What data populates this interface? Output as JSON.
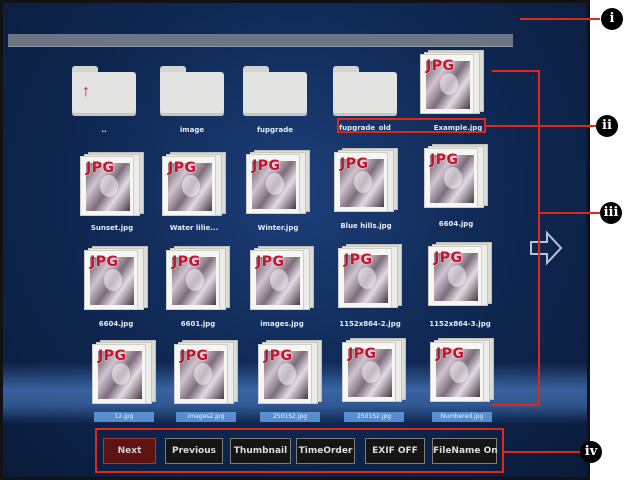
{
  "screen": {
    "topbar": {
      "text": ""
    },
    "folders": [
      {
        "name": "..",
        "mark": "↑"
      },
      {
        "name": "image",
        "mark": ""
      },
      {
        "name": "fupgrade",
        "mark": ""
      },
      {
        "name": "fupgrade_old",
        "mark": ""
      }
    ],
    "files": [
      {
        "name": "Example.jpg",
        "badge": "JPG"
      },
      {
        "name": "Sunset.jpg",
        "badge": "JPG"
      },
      {
        "name": "Water lilie...",
        "badge": "JPG"
      },
      {
        "name": "Winter.jpg",
        "badge": "JPG"
      },
      {
        "name": "Blue hills.jpg",
        "badge": "JPG"
      },
      {
        "name": "6604.jpg",
        "badge": "JPG"
      },
      {
        "name": "6604.jpg",
        "badge": "JPG"
      },
      {
        "name": "6601.jpg",
        "badge": "JPG"
      },
      {
        "name": "images.jpg",
        "badge": "JPG"
      },
      {
        "name": "1152x864-2.jpg",
        "badge": "JPG"
      },
      {
        "name": "1152x864-3.jpg",
        "badge": "JPG"
      },
      {
        "name": "12.jpg",
        "badge": "JPG"
      },
      {
        "name": "images2.jpg",
        "badge": "JPG"
      },
      {
        "name": "2501S2.jpg",
        "badge": "JPG"
      },
      {
        "name": "2501S2.jpg",
        "badge": "JPG"
      },
      {
        "name": "Numbered.jpg",
        "badge": "JPG"
      }
    ],
    "next_page_icon": "right-arrow-outline-icon"
  },
  "toolbar": {
    "buttons": [
      {
        "label": "Next",
        "active": true
      },
      {
        "label": "Previous",
        "active": false
      },
      {
        "label": "Thumbnail",
        "active": false
      },
      {
        "label": "TimeOrder",
        "active": false
      },
      {
        "label": "EXIF OFF",
        "active": false
      },
      {
        "label": "FileName On",
        "active": false
      }
    ]
  },
  "callouts": [
    {
      "id": "i",
      "label": "i"
    },
    {
      "id": "ii",
      "label": "ii"
    },
    {
      "id": "iii",
      "label": "iii"
    },
    {
      "id": "iv",
      "label": "iv"
    }
  ],
  "colors": {
    "callout": "#e0281a",
    "active_button": "#5e1313",
    "jpg_badge": "#c8102e",
    "background": "#102a56"
  }
}
